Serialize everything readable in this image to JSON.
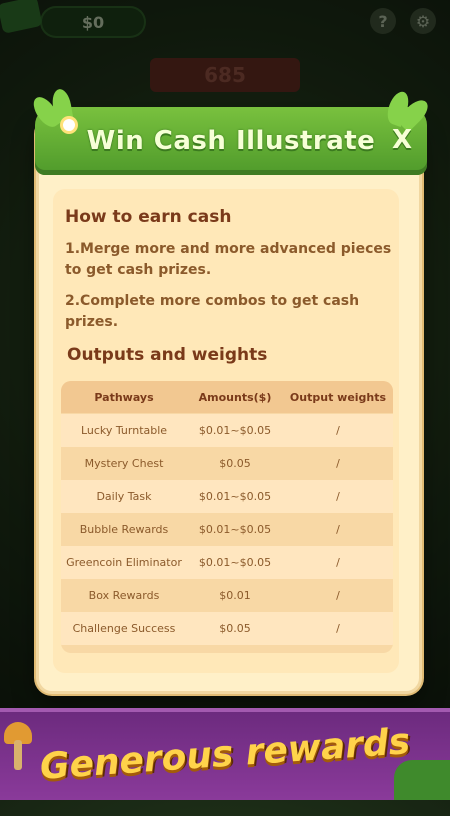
{
  "top_bar": {
    "cash_value": "$0",
    "help_icon": "?",
    "settings_icon": "gear-icon"
  },
  "background": {
    "score": "685"
  },
  "modal": {
    "title": "Win Cash Illustrate",
    "close_icon": "X",
    "how_to_title": "How to earn cash",
    "rules": [
      "1.Merge more and more advanced pieces to get cash prizes.",
      "2.Complete more combos to get cash prizes."
    ],
    "outputs_title": "Outputs and weights",
    "table": {
      "headers": [
        "Pathways",
        "Amounts($)",
        "Output weights"
      ],
      "rows": [
        [
          "Lucky Turntable",
          "$0.01~$0.05",
          "/"
        ],
        [
          "Mystery Chest",
          "$0.05",
          "/"
        ],
        [
          "Daily Task",
          "$0.01~$0.05",
          "/"
        ],
        [
          "Bubble Rewards",
          "$0.01~$0.05",
          "/"
        ],
        [
          "Greencoin Eliminator",
          "$0.01~$0.05",
          "/"
        ],
        [
          "Box Rewards",
          "$0.01",
          "/"
        ],
        [
          "Challenge Success",
          "$0.05",
          "/"
        ]
      ]
    }
  },
  "banner": {
    "text": "Generous rewards"
  },
  "colors": {
    "modal_header_green": "#5aa833",
    "modal_background": "#fff0c8",
    "banner_purple": "#7a3289",
    "banner_text_yellow": "#ffd34a",
    "title_brown": "#7a3a1a"
  }
}
